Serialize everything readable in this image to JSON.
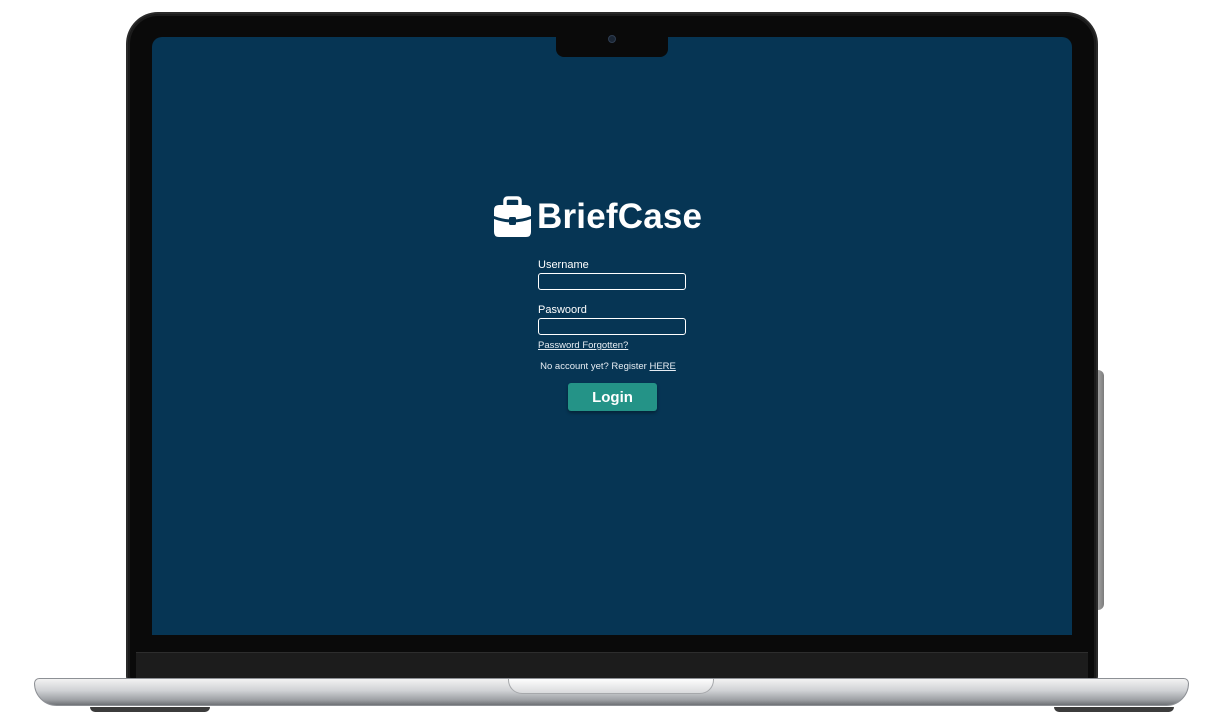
{
  "app": {
    "brand_name": "BriefCase",
    "brand_icon": "briefcase-icon",
    "background_color": "#063554",
    "accent_color": "#249387"
  },
  "login_form": {
    "username_label": "Username",
    "username_value": "",
    "password_label": "Paswoord",
    "password_value": "",
    "forgot_link": "Password Forgotten?",
    "register_text": "No account yet? Register",
    "register_link": "HERE",
    "login_button": "Login"
  }
}
